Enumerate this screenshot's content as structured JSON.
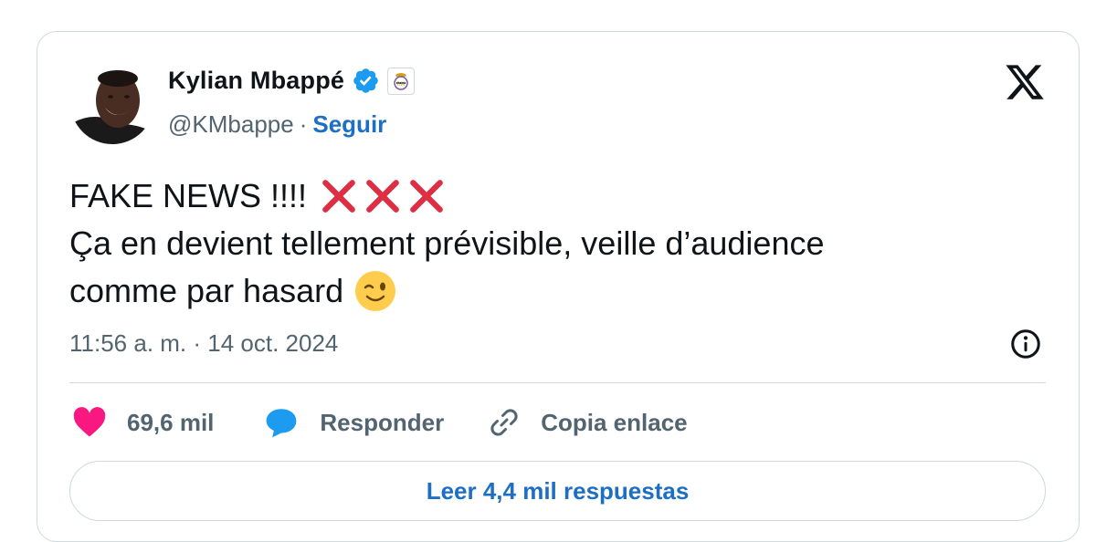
{
  "author": {
    "name": "Kylian Mbappé",
    "handle": "@KMbappe",
    "separator": "·",
    "follow_label": "Seguir",
    "badge_icon": "real-madrid-crest-icon",
    "verified_color": "#1d9bf0"
  },
  "tweet": {
    "line1": "FAKE NEWS !!!!",
    "line1_icons": [
      "cross-mark-icon",
      "cross-mark-icon",
      "cross-mark-icon"
    ],
    "line2": "Ça en devient tellement prévisible, veille d’audience",
    "line3": "comme par hasard",
    "line3_icon": "winking-face-icon",
    "timestamp": "11:56 a. m. · 14 oct. 2024"
  },
  "actions": {
    "like_count": "69,6 mil",
    "reply_label": "Responder",
    "copy_label": "Copia enlace",
    "read_replies_label": "Leer 4,4 mil respuestas"
  },
  "colors": {
    "link": "#1d6fc4",
    "muted": "#536471",
    "like": "#f91880",
    "reply": "#1d9bf0",
    "cross": "#dd2e44",
    "border": "#cfd9de"
  }
}
